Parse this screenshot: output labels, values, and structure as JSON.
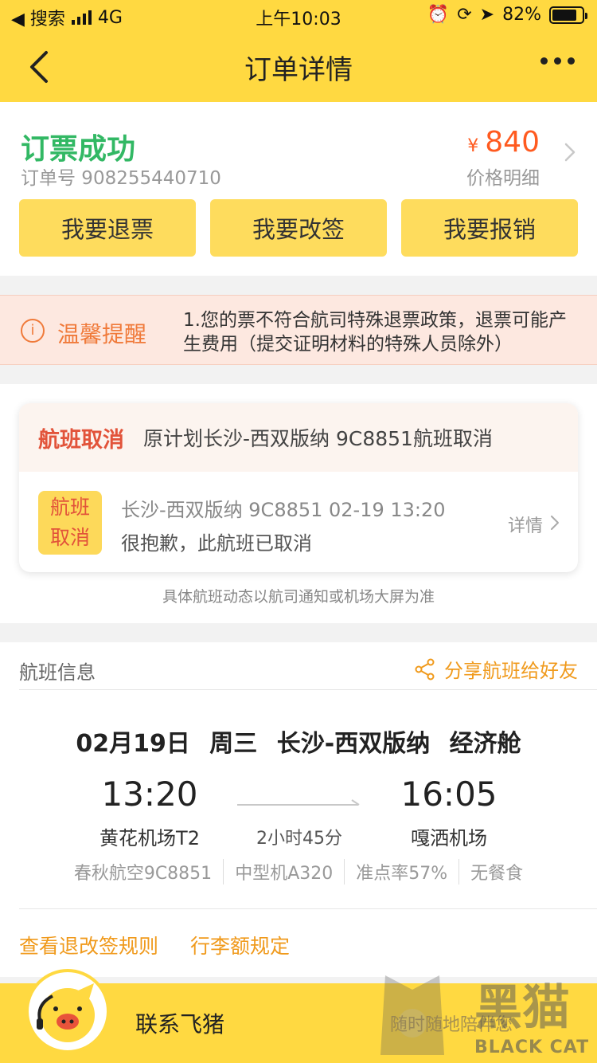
{
  "status_bar": {
    "back_app": "◀ 搜索",
    "network": "4G",
    "time": "上午10:03",
    "battery": "82%",
    "battery_level": 0.82
  },
  "nav": {
    "title": "订单详情"
  },
  "order": {
    "status": "订票成功",
    "order_no": "订单号 908255440710",
    "currency": "¥",
    "price": "840",
    "price_detail": "价格明细",
    "actions": [
      "我要退票",
      "我要改签",
      "我要报销"
    ]
  },
  "tip": {
    "icon": "i",
    "title": "温馨提醒",
    "text": "1.您的票不符合航司特殊退票政策，退票可能产生费用（提交证明材料的特殊人员除外）"
  },
  "cancel": {
    "tag": "航班取消",
    "desc": "原计划长沙-西双版纳 9C8851航班取消",
    "badge_line1": "航班",
    "badge_line2": "取消",
    "flight_line": "长沙-西双版纳 9C8851 02-19 13:20",
    "message": "很抱歉，此航班已取消",
    "detail": "详情",
    "note": "具体航班动态以航司通知或机场大屏为准"
  },
  "flight": {
    "title": "航班信息",
    "share": "分享航班给好友",
    "date_line": "02月19日 周三  长沙-西双版纳  经济舱",
    "dep_time": "13:20",
    "arr_time": "16:05",
    "dep_airport": "黄花机场T2",
    "arr_airport": "嘎洒机场",
    "duration": "2小时45分",
    "meta": [
      "春秋航空9C8851",
      "中型机A320",
      "准点率57%",
      "无餐食"
    ],
    "links": [
      "查看退改签规则",
      "行李额规定"
    ]
  },
  "bottom": {
    "contact": "联系飞猪",
    "slogan": "随时随地陪伴您",
    "watermark": "黑猫",
    "watermark_sub": "BLACK CAT"
  },
  "colors": {
    "brand_yellow": "#ffd941",
    "success_green": "#32b864",
    "price_orange": "#ff5a1f",
    "warn_orange": "#f07a3a",
    "link_orange": "#f09a1c",
    "cancel_red": "#e2533a"
  }
}
